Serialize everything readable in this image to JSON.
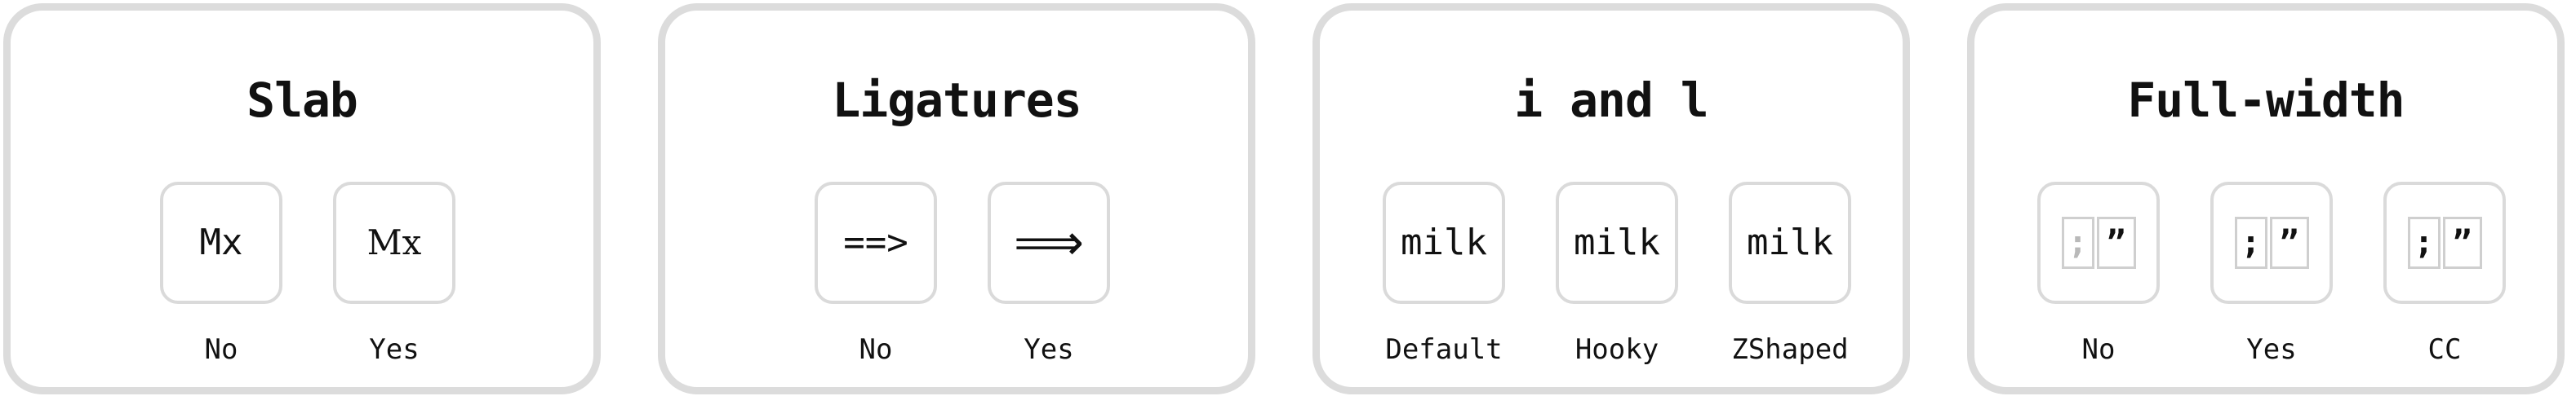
{
  "panels": [
    {
      "title": "Slab",
      "options": [
        {
          "sample": "Mx",
          "label": "No"
        },
        {
          "sample": "Mx",
          "label": "Yes"
        }
      ]
    },
    {
      "title": "Ligatures",
      "options": [
        {
          "sample": "==>",
          "label": "No"
        },
        {
          "sample": "⟹",
          "label": "Yes"
        }
      ]
    },
    {
      "title": "i and l",
      "options": [
        {
          "sample": "milk",
          "label": "Default"
        },
        {
          "sample": "milk",
          "label": "Hooky"
        },
        {
          "sample": "milk",
          "label": "ZShaped"
        }
      ]
    },
    {
      "title": "Full-width",
      "options": [
        {
          "sample_left": ";",
          "sample_right": "”",
          "label": "No"
        },
        {
          "sample_left": ";",
          "sample_right": "”",
          "label": "Yes"
        },
        {
          "sample_left": ";",
          "sample_right": "”",
          "label": "CC"
        }
      ]
    }
  ],
  "colors": {
    "card_border": "#dcdcdc",
    "tile_border": "#dadada",
    "text": "#111111",
    "dim_glyph": "#b9b9b9"
  }
}
